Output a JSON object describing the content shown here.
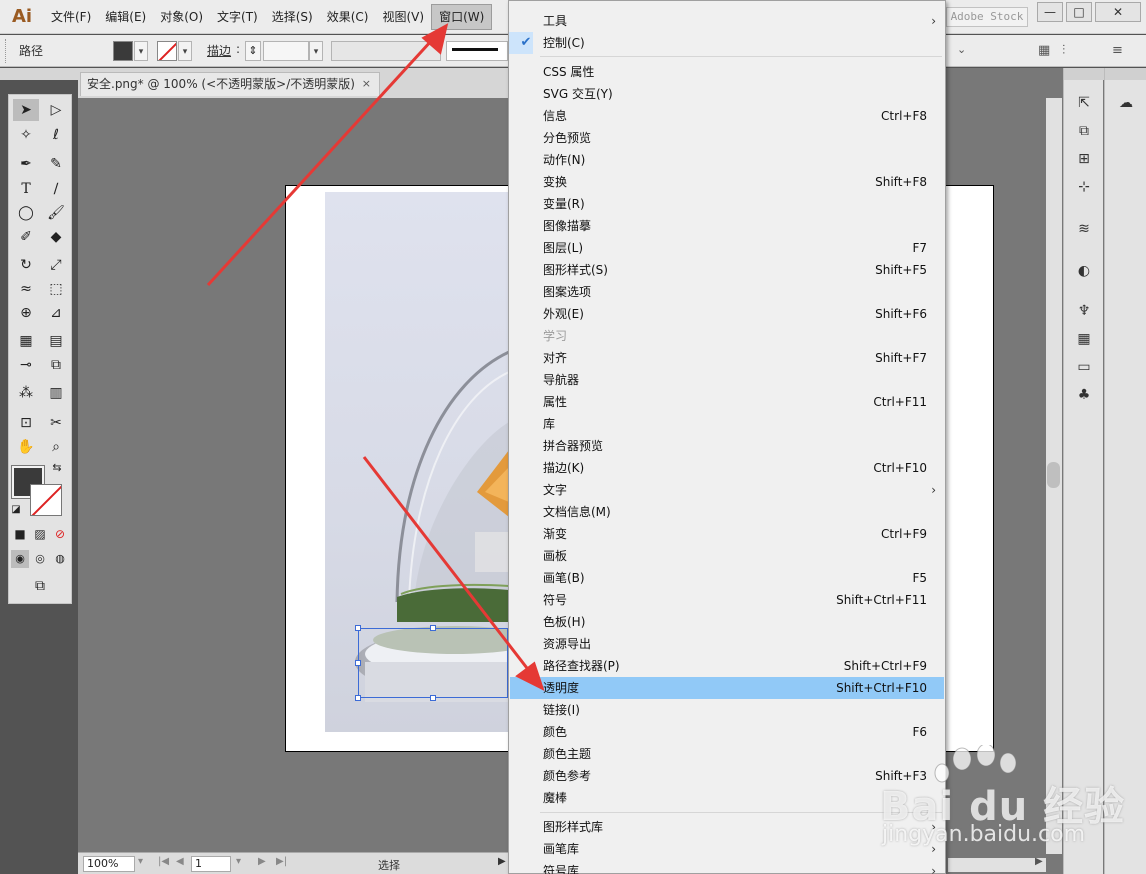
{
  "app": {
    "logo_text": "Ai"
  },
  "menubar": {
    "items": [
      {
        "label": "文件(F)"
      },
      {
        "label": "编辑(E)"
      },
      {
        "label": "对象(O)"
      },
      {
        "label": "文字(T)"
      },
      {
        "label": "选择(S)"
      },
      {
        "label": "效果(C)"
      },
      {
        "label": "视图(V)"
      },
      {
        "label": "窗口(W)"
      }
    ],
    "stock_search": "Adobe Stock",
    "minimize": "—",
    "maximize": "□",
    "close": "✕"
  },
  "control_bar": {
    "object_type": "路径",
    "stroke_label": "描边",
    "stroke_colon": ":",
    "up_down": "⇕",
    "stroke_weight": "",
    "fill_color": "#3a3a3a"
  },
  "document": {
    "tab_title": "安全.png* @ 100% (<不透明蒙版>/不透明蒙版)",
    "tab_close": "×"
  },
  "status_bar": {
    "zoom": "100%",
    "page": "1",
    "status": "选择",
    "first": "|◀",
    "prev": "◀",
    "next": "▶",
    "last": "▶|"
  },
  "window_menu": {
    "items": [
      {
        "label": "工具",
        "shortcut": "",
        "submenu": "›"
      },
      {
        "label": "控制(C)",
        "shortcut": "",
        "checked": "✔"
      },
      {
        "label": "CSS 属性",
        "shortcut": ""
      },
      {
        "label": "SVG 交互(Y)",
        "shortcut": ""
      },
      {
        "label": "信息",
        "shortcut": "Ctrl+F8"
      },
      {
        "label": "分色预览",
        "shortcut": ""
      },
      {
        "label": "动作(N)",
        "shortcut": ""
      },
      {
        "label": "变换",
        "shortcut": "Shift+F8"
      },
      {
        "label": "变量(R)",
        "shortcut": ""
      },
      {
        "label": "图像描摹",
        "shortcut": ""
      },
      {
        "label": "图层(L)",
        "shortcut": "F7"
      },
      {
        "label": "图形样式(S)",
        "shortcut": "Shift+F5"
      },
      {
        "label": "图案选项",
        "shortcut": ""
      },
      {
        "label": "外观(E)",
        "shortcut": "Shift+F6"
      },
      {
        "label": "学习",
        "shortcut": ""
      },
      {
        "label": "对齐",
        "shortcut": "Shift+F7"
      },
      {
        "label": "导航器",
        "shortcut": ""
      },
      {
        "label": "属性",
        "shortcut": "Ctrl+F11"
      },
      {
        "label": "库",
        "shortcut": ""
      },
      {
        "label": "拼合器预览",
        "shortcut": ""
      },
      {
        "label": "描边(K)",
        "shortcut": "Ctrl+F10"
      },
      {
        "label": "文字",
        "shortcut": "",
        "submenu": "›"
      },
      {
        "label": "文档信息(M)",
        "shortcut": ""
      },
      {
        "label": "渐变",
        "shortcut": "Ctrl+F9"
      },
      {
        "label": "画板",
        "shortcut": ""
      },
      {
        "label": "画笔(B)",
        "shortcut": "F5"
      },
      {
        "label": "符号",
        "shortcut": "Shift+Ctrl+F11"
      },
      {
        "label": "色板(H)",
        "shortcut": ""
      },
      {
        "label": "资源导出",
        "shortcut": ""
      },
      {
        "label": "路径查找器(P)",
        "shortcut": "Shift+Ctrl+F9"
      },
      {
        "label": "透明度",
        "shortcut": "Shift+Ctrl+F10"
      },
      {
        "label": "链接(I)",
        "shortcut": ""
      },
      {
        "label": "颜色",
        "shortcut": "F6"
      },
      {
        "label": "颜色主题",
        "shortcut": ""
      },
      {
        "label": "颜色参考",
        "shortcut": "Shift+F3"
      },
      {
        "label": "魔棒",
        "shortcut": ""
      },
      {
        "label": "图形样式库",
        "shortcut": "",
        "submenu": "›"
      },
      {
        "label": "画笔库",
        "shortcut": "",
        "submenu": "›"
      },
      {
        "label": "符号库",
        "shortcut": "",
        "submenu": "›"
      }
    ]
  },
  "tools": {
    "selection": "➤",
    "direct_selection": "▷",
    "magic_wand": "✧",
    "lasso": "ℓ",
    "pen": "✒",
    "curvature": "✎",
    "type": "T",
    "line": "∕",
    "ellipse": "◯",
    "paintbrush": "🖌",
    "shaper": "✐",
    "eraser": "◆",
    "rotate": "↻",
    "scale": "⤢",
    "warp": "≈",
    "free_transform": "⬚",
    "shape_builder": "⊕",
    "perspective": "⊿",
    "mesh": "▦",
    "gradient": "▤",
    "eyedropper": "⊸",
    "blend": "⧉",
    "symbol_sprayer": "⁂",
    "graph": "▥",
    "artboard": "⊡",
    "slice": "✂",
    "hand": "✋",
    "zoom": "⌕",
    "swap": "⇆",
    "default": "◪",
    "color": "■",
    "gradient_mode": "▨",
    "none": "⊘",
    "draw_normal": "◉",
    "draw_behind": "◎",
    "draw_inside": "◍",
    "screen_mode": "⧉"
  },
  "dock": {
    "export": "⇱",
    "layers_copy": "⧉",
    "artboards": "⊞",
    "transform": "⊹",
    "layers": "≋",
    "appearance": "◐",
    "brushes": "♆",
    "swatches": "▦",
    "gradient": "▭",
    "symbols": "♣",
    "cc_libraries": "☁"
  },
  "watermark": {
    "brand": "Bai du 经验",
    "url": "jingyan.baidu.com"
  },
  "colors": {
    "highlight": "#91c9f7",
    "arrow": "#e53935",
    "selection": "#3c6bd6"
  }
}
